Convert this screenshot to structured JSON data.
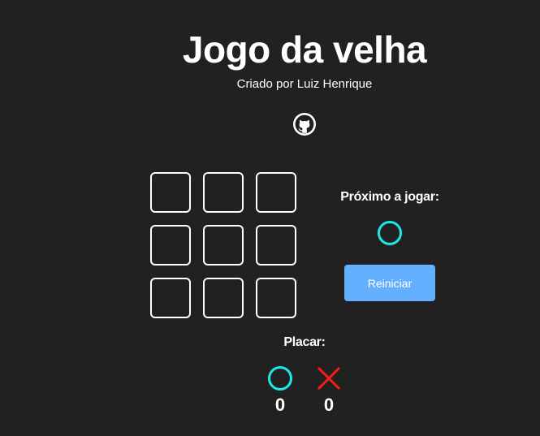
{
  "header": {
    "title": "Jogo da velha",
    "subtitle": "Criado por Luiz Henrique",
    "github_icon": "github-icon"
  },
  "board": {
    "cells": [
      "",
      "",
      "",
      "",
      "",
      "",
      "",
      "",
      ""
    ]
  },
  "turn": {
    "label": "Próximo a jogar:",
    "current_player": "O",
    "player_icon": "circle-icon"
  },
  "controls": {
    "restart_label": "Reiniciar"
  },
  "score": {
    "label": "Placar:",
    "o_icon": "circle-icon",
    "x_icon": "cross-icon",
    "o_value": "0",
    "x_value": "0"
  },
  "colors": {
    "background": "#212121",
    "text": "#ffffff",
    "player_o": "#1de9e9",
    "player_x": "#ff1a1a",
    "button": "#64b0ff"
  }
}
